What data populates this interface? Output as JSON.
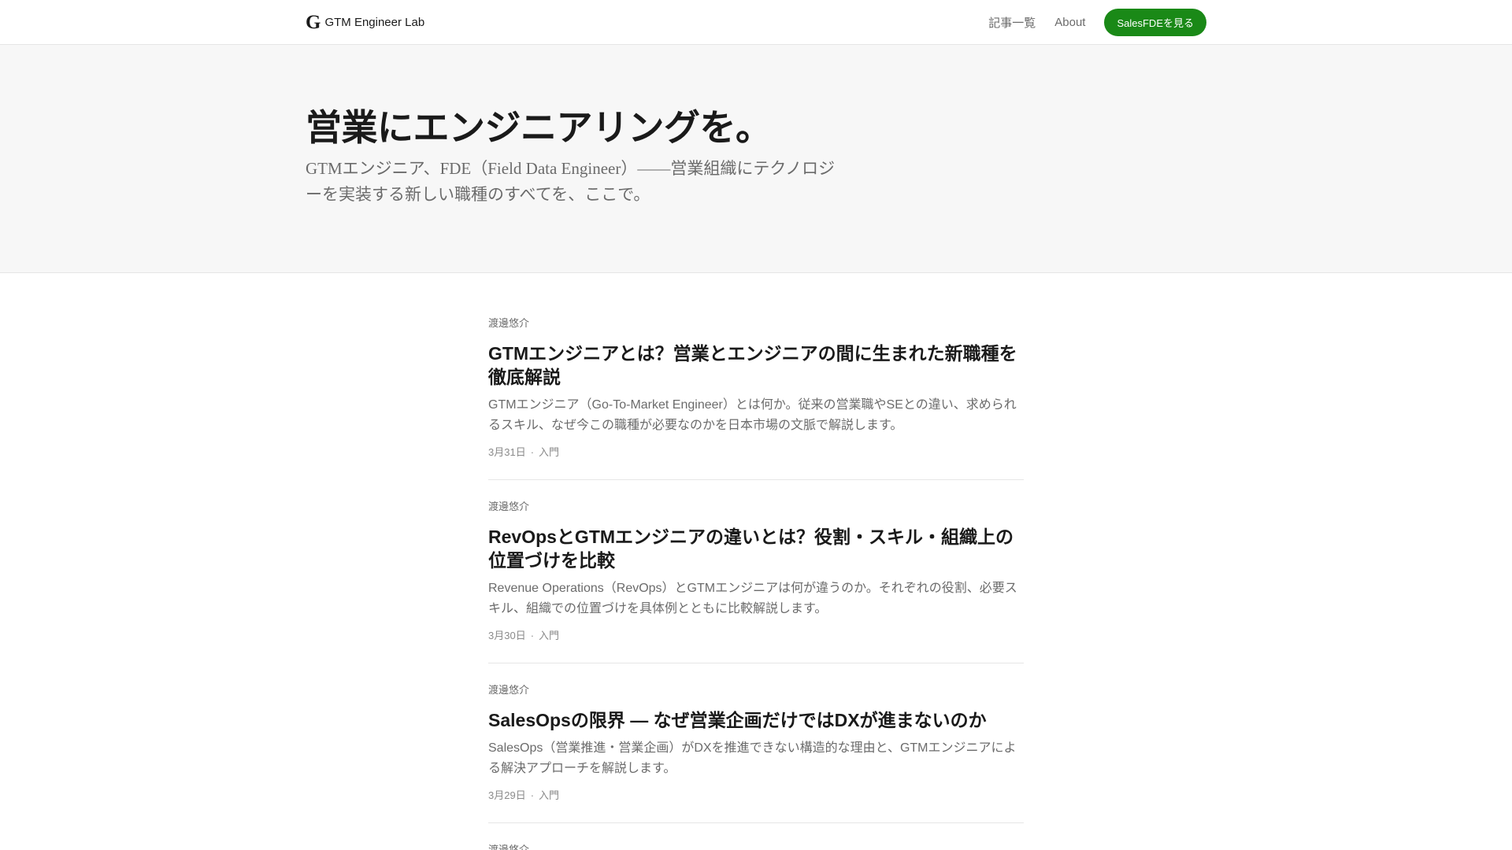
{
  "header": {
    "logo_mark": "G",
    "brand_name": "GTM Engineer Lab",
    "nav": {
      "articles_label": "記事一覧",
      "about_label": "About",
      "cta_label": "SalesFDEを見る"
    }
  },
  "hero": {
    "title": "営業にエンジニアリングを。",
    "subtitle": "GTMエンジニア、FDE（Field Data Engineer）——営業組織にテクノロジーを実装する新しい職種のすべてを、ここで。"
  },
  "articles": [
    {
      "author": "渡邊悠介",
      "title": "GTMエンジニアとは？営業とエンジニアの間に生まれた新職種を徹底解説",
      "description": "GTMエンジニア（Go-To-Market Engineer）とは何か。従来の営業職やSEとの違い、求められるスキル、なぜ今この職種が必要なのかを日本市場の文脈で解説します。",
      "date": "3月31日",
      "separator": "·",
      "category": "入門"
    },
    {
      "author": "渡邊悠介",
      "title": "RevOpsとGTMエンジニアの違いとは？役割・スキル・組織上の位置づけを比較",
      "description": "Revenue Operations（RevOps）とGTMエンジニアは何が違うのか。それぞれの役割、必要スキル、組織での位置づけを具体例とともに比較解説します。",
      "date": "3月30日",
      "separator": "·",
      "category": "入門"
    },
    {
      "author": "渡邊悠介",
      "title": "SalesOpsの限界 — なぜ営業企画だけではDXが進まないのか",
      "description": "SalesOps（営業推進・営業企画）がDXを推進できない構造的な理由と、GTMエンジニアによる解決アプローチを解説します。",
      "date": "3月29日",
      "separator": "·",
      "category": "入門"
    },
    {
      "author": "渡邊悠介"
    }
  ],
  "colors": {
    "accent": "#1a8917",
    "hero_bg": "#f7f7f7"
  }
}
